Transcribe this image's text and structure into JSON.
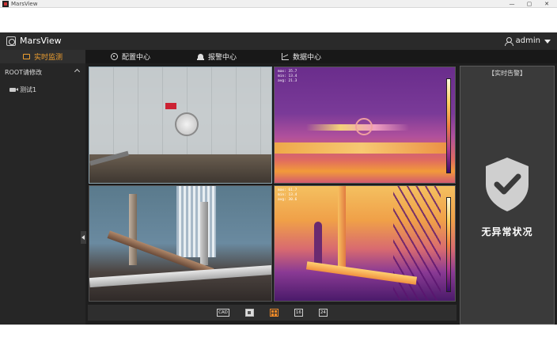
{
  "os_window": {
    "title": "MarsView",
    "controls": [
      "—",
      "▢",
      "✕"
    ]
  },
  "header": {
    "app_name": "MarsView",
    "user": "admin"
  },
  "nav": {
    "items": [
      {
        "label": "实时监测",
        "icon": "monitor-icon",
        "active": true
      },
      {
        "label": "配置中心",
        "icon": "gear-icon",
        "active": false
      },
      {
        "label": "报警中心",
        "icon": "alarm-icon",
        "active": false
      },
      {
        "label": "数据中心",
        "icon": "chart-icon",
        "active": false
      }
    ]
  },
  "sidebar": {
    "root_label": "ROOT请修改",
    "devices": [
      {
        "label": "测试1",
        "icon": "camera-icon"
      }
    ]
  },
  "video_grid": {
    "tiles": [
      {
        "type": "visible",
        "scene": "storage tank"
      },
      {
        "type": "thermal",
        "scene": "storage tank",
        "overlay": "max: 35.7\nmin: 13.4\navg: 21.3"
      },
      {
        "type": "visible",
        "scene": "pipes and valves"
      },
      {
        "type": "thermal",
        "scene": "pipes and valves",
        "overlay": "max: 61.7\nmin: 13.4\navg: 30.6"
      }
    ]
  },
  "toolbar": {
    "buttons": [
      {
        "label": "CAD",
        "name": "cad-button"
      },
      {
        "label": "",
        "name": "layout-1-button"
      },
      {
        "label": "",
        "name": "layout-4-button",
        "active": true
      },
      {
        "label": "16",
        "name": "layout-16-button"
      },
      {
        "label": "24",
        "name": "layout-24-button"
      }
    ]
  },
  "alarm_panel": {
    "title": "【实时告警】",
    "status": "无异常状况"
  },
  "colors": {
    "accent": "#f08a28",
    "background": "#1e1e1e"
  }
}
